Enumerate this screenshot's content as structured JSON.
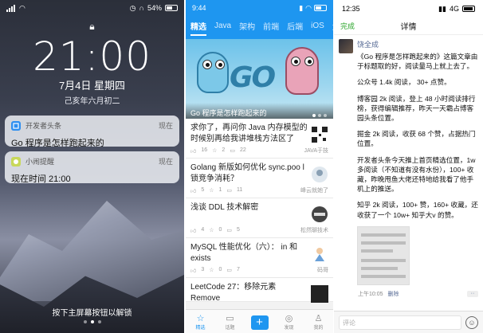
{
  "lock": {
    "status": {
      "battery": "54%"
    },
    "time": "21:00",
    "date": "7月4日 星期四",
    "lunar": "己亥年六月初二",
    "notifications": [
      {
        "app": "开发者头条",
        "when": "现在",
        "body": "Go 程序是怎样跑起来的",
        "icon": "news-app-icon",
        "icon_color": "#2f8ff0"
      },
      {
        "app": "小闹提醒",
        "when": "现在",
        "body": "现在时间 21:00",
        "icon": "alarm-app-icon",
        "icon_color": "#c8d85a"
      }
    ],
    "hint": "按下主屏幕按钮以解锁"
  },
  "news": {
    "status": {
      "time": "9:44"
    },
    "tabs": [
      "精选",
      "Java",
      "架构",
      "前端",
      "后端",
      "iOS",
      "大"
    ],
    "hero": {
      "caption": "Go 程序是怎样跑起来的",
      "logo_text": "GO"
    },
    "articles": [
      {
        "title": "求你了，再问你 Java 内存模型的时候别再给我讲堆栈方法区了",
        "likes": "16",
        "stars": "2",
        "comments": "22",
        "source": "JAVA于技"
      },
      {
        "title": "Golang 新版如何优化 sync.poo l锁竞争消耗？",
        "likes": "5",
        "stars": "1",
        "comments": "11",
        "source": "峰云就她了"
      },
      {
        "title": "浅谈 DDL 技术解密",
        "likes": "4",
        "stars": "0",
        "comments": "5",
        "source": "松然聊技术"
      },
      {
        "title": "MySQL 性能优化（六）： in 和 exists",
        "likes": "3",
        "stars": "0",
        "comments": "7",
        "source": "码哥"
      },
      {
        "title": "LeetCode 27：移除元素 Remove",
        "likes": "",
        "stars": "",
        "comments": "",
        "source": ""
      }
    ],
    "bottom_nav": [
      {
        "label": "精选",
        "icon": "star-icon",
        "glyph": "☆",
        "active": true
      },
      {
        "label": "话题",
        "icon": "chat-icon",
        "glyph": "▭",
        "active": false
      },
      {
        "label": "",
        "icon": "plus-icon",
        "glyph": "+",
        "active": false
      },
      {
        "label": "发现",
        "icon": "compass-icon",
        "glyph": "◎",
        "active": false
      },
      {
        "label": "我的",
        "icon": "person-icon",
        "glyph": "♙",
        "active": false
      }
    ]
  },
  "detail": {
    "status": {
      "time": "12:35",
      "network": "4G"
    },
    "done": "完成",
    "title": "详情",
    "author": "饶全成",
    "paragraphs": [
      "《Go 程序是怎样跑起来的》这篇文章由于标题取的好，阅读量马上就上去了。",
      "公众号 1.4k 阅读， 30+ 点赞。",
      "博客园 2k 阅读，登上 48 小时阅读排行榜，获得编辑推荐，昨天一天霸占博客园头条位置。",
      "掘金 2k 阅读，收获 68 个赞，占据热门位置。",
      "开发者头条今天推上首页精选位置，1w 多阅读（不知道有没有水份），100+ 收藏，昨晚甩鱼大佬还特地给我看了他手机上的推送。",
      "知乎 2k 阅读，100+ 赞，160+ 收藏，还收获了一个 10w+ 知乎大v 的赞。"
    ],
    "post_time": "上午10:05",
    "delete": "删除",
    "more": "··",
    "comment_placeholder": "评论"
  }
}
